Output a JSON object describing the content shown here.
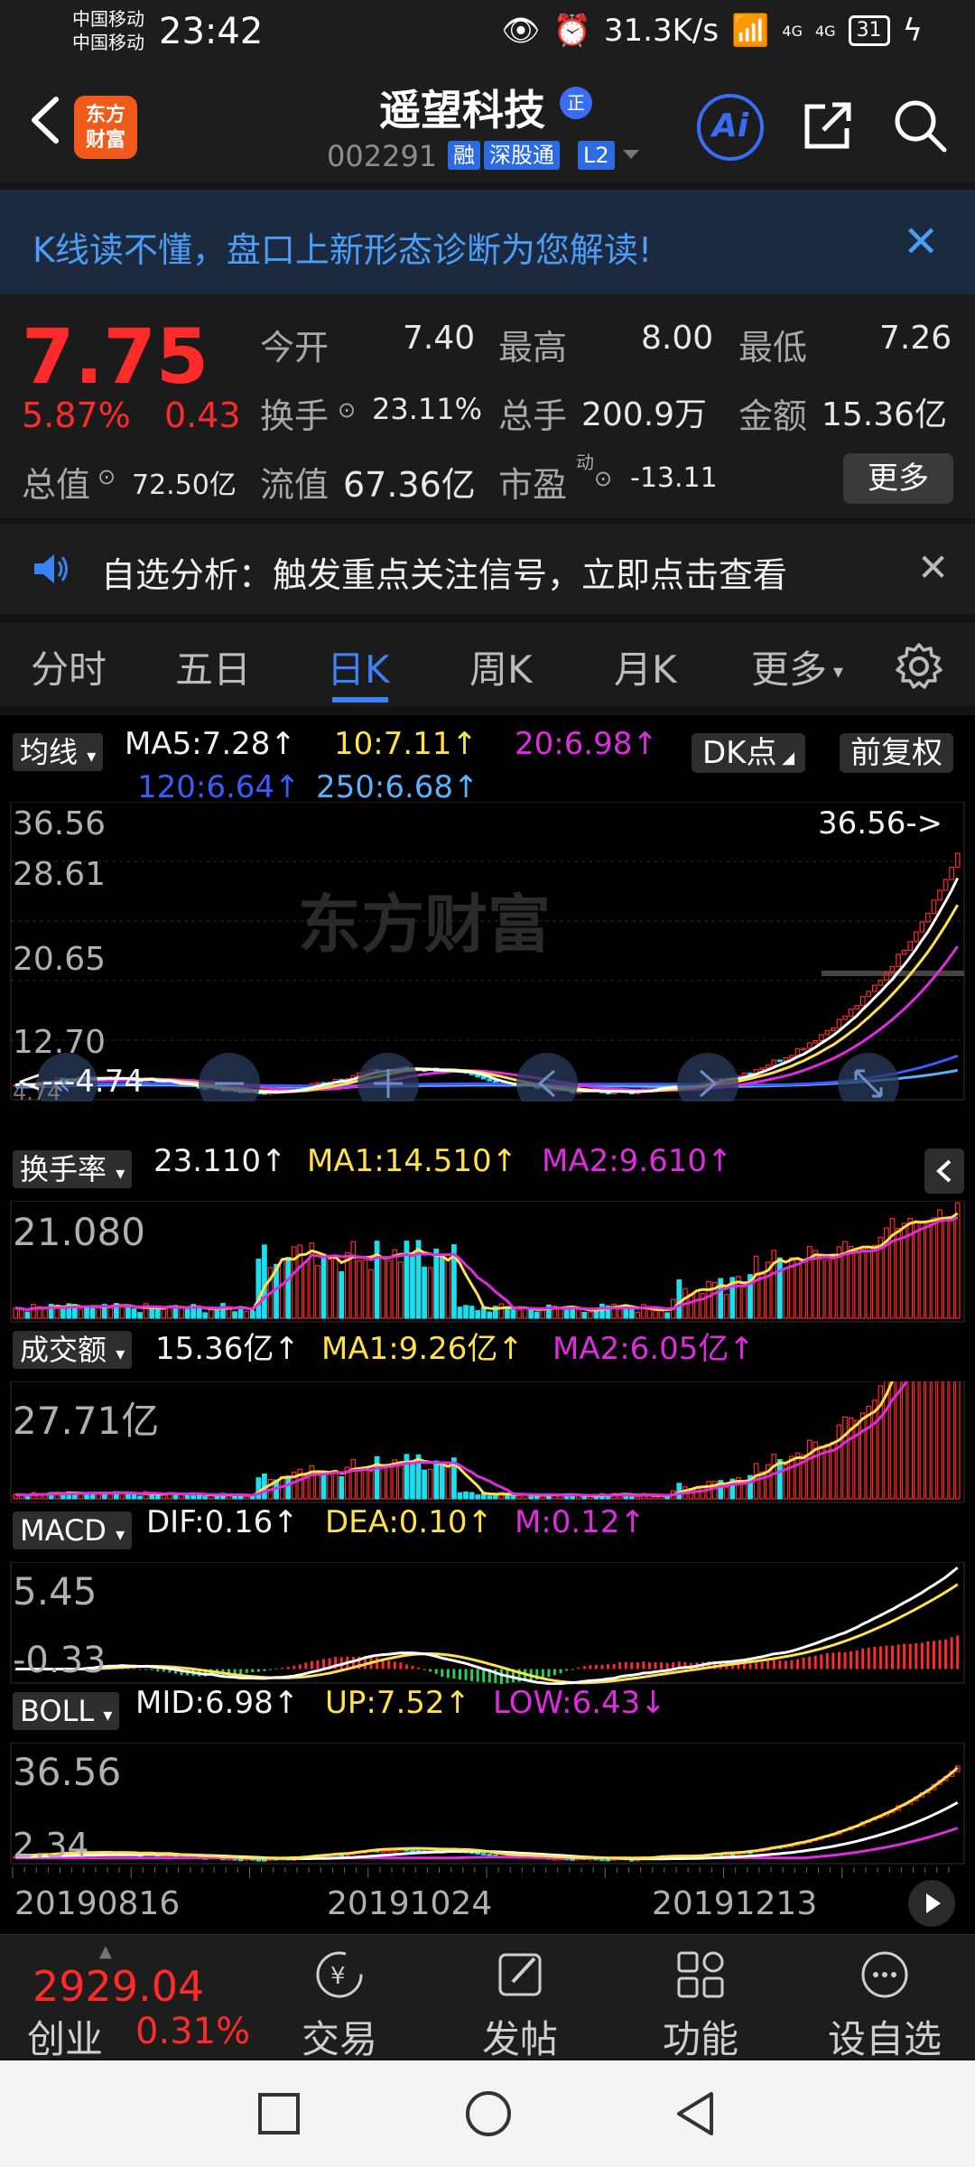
{
  "status_bar": {
    "carrier1": "中国移动",
    "carrier2": "中国移动",
    "time": "23:42",
    "net_speed": "31.3K/s",
    "signal1": "4G",
    "signal2": "4G",
    "battery": "31"
  },
  "header": {
    "logo_line1": "东方",
    "logo_line2": "财富",
    "stock_name": "遥望科技",
    "badge": "正",
    "code": "002291",
    "tags": [
      "融",
      "深股通",
      "L2"
    ],
    "ai_label": "Ai"
  },
  "banner": {
    "text": "K线读不懂，盘口上新形态诊断为您解读!",
    "close": "✕"
  },
  "quote": {
    "price": "7.75",
    "change_pct": "5.87%",
    "change_amt": "0.43",
    "open_label": "今开",
    "open_value": "7.40",
    "high_label": "最高",
    "high_value": "8.00",
    "low_label": "最低",
    "low_value": "7.26",
    "turnover_label": "换手",
    "turnover_value": "23.11%",
    "volume_label": "总手",
    "volume_value": "200.9万",
    "amount_label": "金额",
    "amount_value": "15.36亿",
    "mktcap_label": "总值",
    "mktcap_value": "72.50亿",
    "float_label": "流值",
    "float_value": "67.36亿",
    "pe_label": "市盈",
    "pe_sup": "动",
    "pe_value": "-13.11",
    "more_button": "更多"
  },
  "notice": {
    "text": "自选分析：触发重点关注信号，立即点击查看",
    "close": "✕"
  },
  "tabs": [
    "分时",
    "五日",
    "日K",
    "周K",
    "月K",
    "更多"
  ],
  "active_tab": "日K",
  "chart": {
    "ma_button": "均线",
    "ma5": "MA5:7.28↑",
    "ma10": "10:7.11↑",
    "ma20": "20:6.98↑",
    "ma120": "120:6.64↑",
    "ma250": "250:6.68↑",
    "dk_button": "DK点",
    "adjust_button": "前复权",
    "price_axis": [
      "36.56",
      "28.61",
      "20.65",
      "12.70",
      "4.74"
    ],
    "max_marker": "36.56->",
    "min_marker": "<---4.74",
    "watermark": "东方财富",
    "turnover_button": "换手率",
    "turnover_value": "23.110↑",
    "turnover_ma1": "MA1:14.510↑",
    "turnover_ma2": "MA2:9.610↑",
    "turnover_axis": "21.080",
    "volume_button": "成交额",
    "volume_value": "15.36亿↑",
    "volume_ma1": "MA1:9.26亿↑",
    "volume_ma2": "MA2:6.05亿↑",
    "volume_axis": "27.71亿",
    "macd_button": "MACD",
    "dif": "DIF:0.16↑",
    "dea": "DEA:0.10↑",
    "m": "M:0.12↑",
    "macd_axis_top": "5.45",
    "macd_axis_bottom": "-0.33",
    "boll_button": "BOLL",
    "mid": "MID:6.98↑",
    "up": "UP:7.52↑",
    "low": "LOW:6.43↓",
    "boll_axis_top": "36.56",
    "boll_axis_bottom": "2.34",
    "dates": [
      "20190816",
      "20191024",
      "20191213"
    ]
  },
  "bottom_nav": {
    "index_value": "2929.04",
    "index_name": "创业",
    "index_pct": "0.31%",
    "items": [
      "交易",
      "发帖",
      "功能",
      "设自选"
    ]
  },
  "colors": {
    "up": "#ff2a2a",
    "down": "#29d152",
    "accent": "#3b82f6",
    "ma5": "#ffffff",
    "ma10": "#ffe14a",
    "ma20": "#e02be0",
    "ma120": "#3b5bff",
    "ma250": "#5ab2ff",
    "cyan_bar": "#19e0f0"
  }
}
